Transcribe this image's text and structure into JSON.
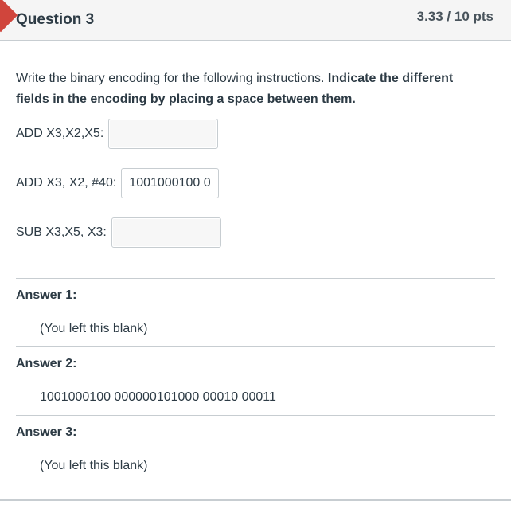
{
  "question": {
    "title": "Question 3",
    "points": "3.33 / 10 pts",
    "flag_color": "#d0453c"
  },
  "prompt": {
    "plain": "Write the binary encoding for the following instructions. ",
    "bold": "Indicate the different fields in the encoding by placing a space between them."
  },
  "blanks": [
    {
      "label": "ADD X3,X2,X5:",
      "value": ""
    },
    {
      "label": "ADD X3, X2, #40:",
      "value": "1001000100 0"
    },
    {
      "label": "SUB X3,X5, X3:",
      "value": ""
    }
  ],
  "answers": [
    {
      "label": "Answer 1:",
      "text": "(You left this blank)"
    },
    {
      "label": "Answer 2:",
      "text": "1001000100 000000101000 00010 00011"
    },
    {
      "label": "Answer 3:",
      "text": "(You left this blank)"
    }
  ]
}
